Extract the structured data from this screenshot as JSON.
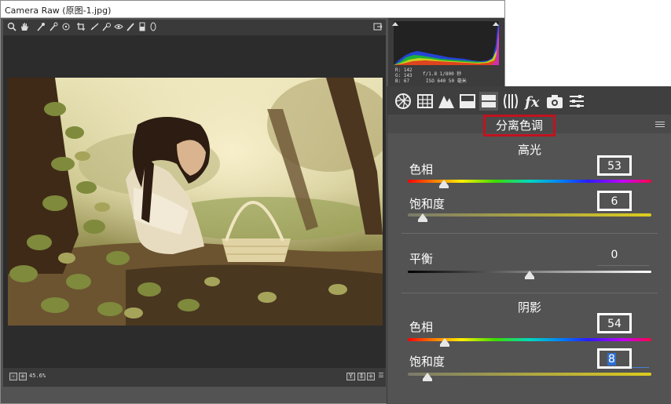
{
  "window": {
    "title": "Camera Raw (原图-1.jpg)"
  },
  "toolbar": {
    "tools": [
      "zoom-icon",
      "hand-icon",
      "white-balance-icon",
      "color-sampler-icon",
      "target-adjust-icon",
      "crop-icon",
      "straighten-icon",
      "spot-removal-icon",
      "red-eye-icon",
      "brush-icon",
      "graduated-filter-icon",
      "radial-filter-icon"
    ],
    "export_icon": "export-icon"
  },
  "statusbar": {
    "zoom": "45.6%"
  },
  "histogram": {
    "rgb": [
      "R: 142",
      "G: 143",
      "B: 67"
    ],
    "camera": [
      "f/1.8  1/800 秒",
      "ISO 640  50 毫米"
    ]
  },
  "panel": {
    "tabs": [
      "basic-icon",
      "tone-curve-icon",
      "detail-icon",
      "hsl-icon",
      "split-toning-icon",
      "lens-icon",
      "fx-icon",
      "camera-calibration-icon",
      "presets-icon"
    ],
    "active_tab": "split-toning-icon",
    "title": "分离色调",
    "highlights": {
      "heading": "高光",
      "hue_label": "色相",
      "hue_value": "53",
      "hue_level": 0.148,
      "sat_label": "饱和度",
      "sat_value": "6",
      "sat_level": 0.06
    },
    "balance": {
      "label": "平衡",
      "value": "0",
      "level": 0.5
    },
    "shadows": {
      "heading": "阴影",
      "hue_label": "色相",
      "hue_value": "54",
      "hue_level": 0.15,
      "sat_label": "饱和度",
      "sat_value": "8",
      "sat_level": 0.08
    }
  },
  "colors": {
    "highlight_box": "#c0131e",
    "panel_bg": "#535353"
  }
}
